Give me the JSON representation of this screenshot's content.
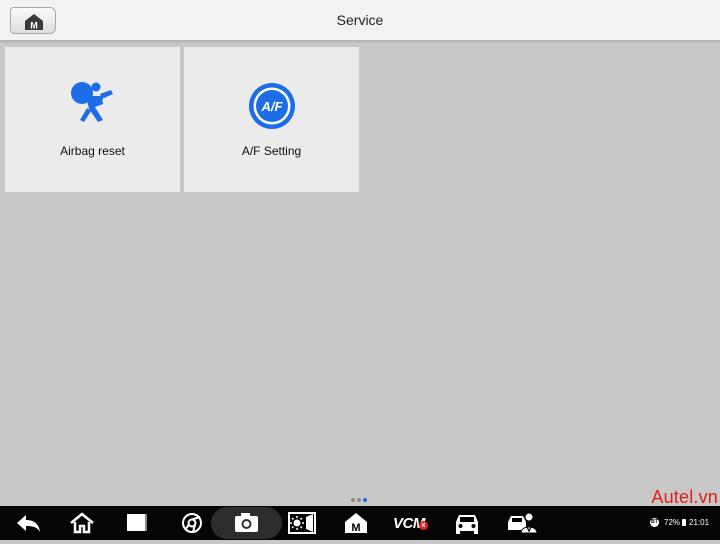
{
  "header": {
    "title": "Service",
    "home_button_letter": "M"
  },
  "tiles": [
    {
      "label": "Airbag reset",
      "icon": "airbag-icon"
    },
    {
      "label": "A/F Setting",
      "icon": "af-setting-icon",
      "icon_text": "A/F"
    }
  ],
  "pager": {
    "pages": 3,
    "active": 2
  },
  "watermark": "Autel.vn",
  "taskbar": {
    "buttons": [
      {
        "icon": "back-icon"
      },
      {
        "icon": "home-icon"
      },
      {
        "icon": "recent-apps-icon"
      },
      {
        "icon": "browser-icon"
      },
      {
        "icon": "camera-icon"
      },
      {
        "icon": "brightness-icon"
      },
      {
        "icon": "maxisys-icon",
        "letter": "M"
      },
      {
        "icon": "vcm-icon",
        "text": "VCM",
        "badge": "x"
      },
      {
        "icon": "vehicle-icon"
      },
      {
        "icon": "technician-icon"
      }
    ],
    "status": {
      "bluetooth_label": "BT",
      "battery": "72%",
      "time": "21:01"
    }
  },
  "colors": {
    "accent": "#1d6ee6",
    "watermark": "#e31c1c",
    "background": "#c8c8c8",
    "tile": "#ebebeb",
    "taskbar": "#050505"
  }
}
